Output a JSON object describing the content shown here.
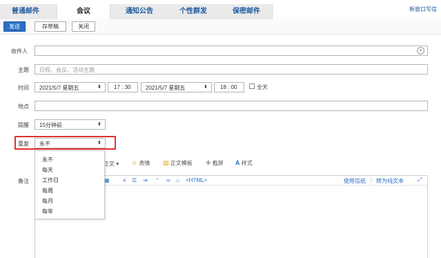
{
  "tabs": [
    {
      "label": "普通邮件"
    },
    {
      "label": "会议"
    },
    {
      "label": "通知公告"
    },
    {
      "label": "个性群发"
    },
    {
      "label": "保密邮件"
    }
  ],
  "new_window": "新窗口写信",
  "toolbar": {
    "send": "发送",
    "draft": "存草稿",
    "close": "关闭"
  },
  "form": {
    "recipient_label": "收件人",
    "subject_label": "主题",
    "subject_placeholder": "日程、会议、活动主题",
    "time_label": "时间",
    "start_date": "2021/5/7 星期五",
    "start_time": "17 : 30",
    "end_date": "2021/5/7 星期五",
    "end_time": "18 : 00",
    "allday_label": "全天",
    "location_label": "地点",
    "reminder_label": "提醒",
    "reminder_value": "15分钟前",
    "repeat_label": "重复",
    "repeat_value": "永不",
    "notes_label": "备注"
  },
  "repeat_options": [
    "永不",
    "每天",
    "工作日",
    "每周",
    "每月",
    "每年"
  ],
  "editor_toolbar": {
    "body_text": "正文",
    "emoji": "表情",
    "template": "正文模板",
    "screenshot": "截屏",
    "style": "样式",
    "html": "<HTML>",
    "use_signature": "使用信纸",
    "to_plain": "转为纯文本"
  },
  "colors": {
    "accent": "#2b6fc4",
    "highlight": "#e03030"
  }
}
